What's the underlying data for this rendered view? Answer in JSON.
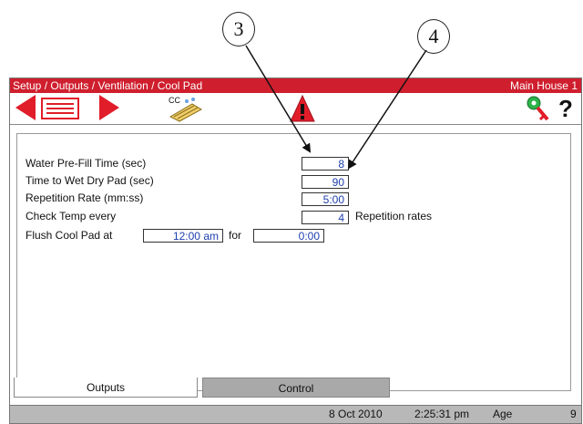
{
  "callouts": {
    "first": "3",
    "second": "4"
  },
  "titlebar": {
    "breadcrumb": "Setup / Outputs / Ventilation / Cool Pad",
    "house": "Main House 1"
  },
  "toolbar": {
    "cc_label": "CC"
  },
  "settings": [
    {
      "label": "Water Pre-Fill Time (sec)",
      "value": "8"
    },
    {
      "label": "Time to Wet Dry Pad (sec)",
      "value": "90"
    },
    {
      "label": "Repetition Rate (mm:ss)",
      "value": "5:00"
    },
    {
      "label": "Check Temp every",
      "value": "4",
      "suffix": "Repetition rates"
    }
  ],
  "flush": {
    "label": "Flush Cool Pad at",
    "time": "12:00 am",
    "for_label": "for",
    "duration": "0:00"
  },
  "tabs": {
    "outputs": "Outputs",
    "control": "Control"
  },
  "status": {
    "date": "8 Oct 2010",
    "time": "2:25:31 pm",
    "age_label": "Age",
    "age_value": "9"
  },
  "colors": {
    "titlebar": "#cf1f2e",
    "value_text": "#1f3fae",
    "status": "#b8b8b8"
  }
}
